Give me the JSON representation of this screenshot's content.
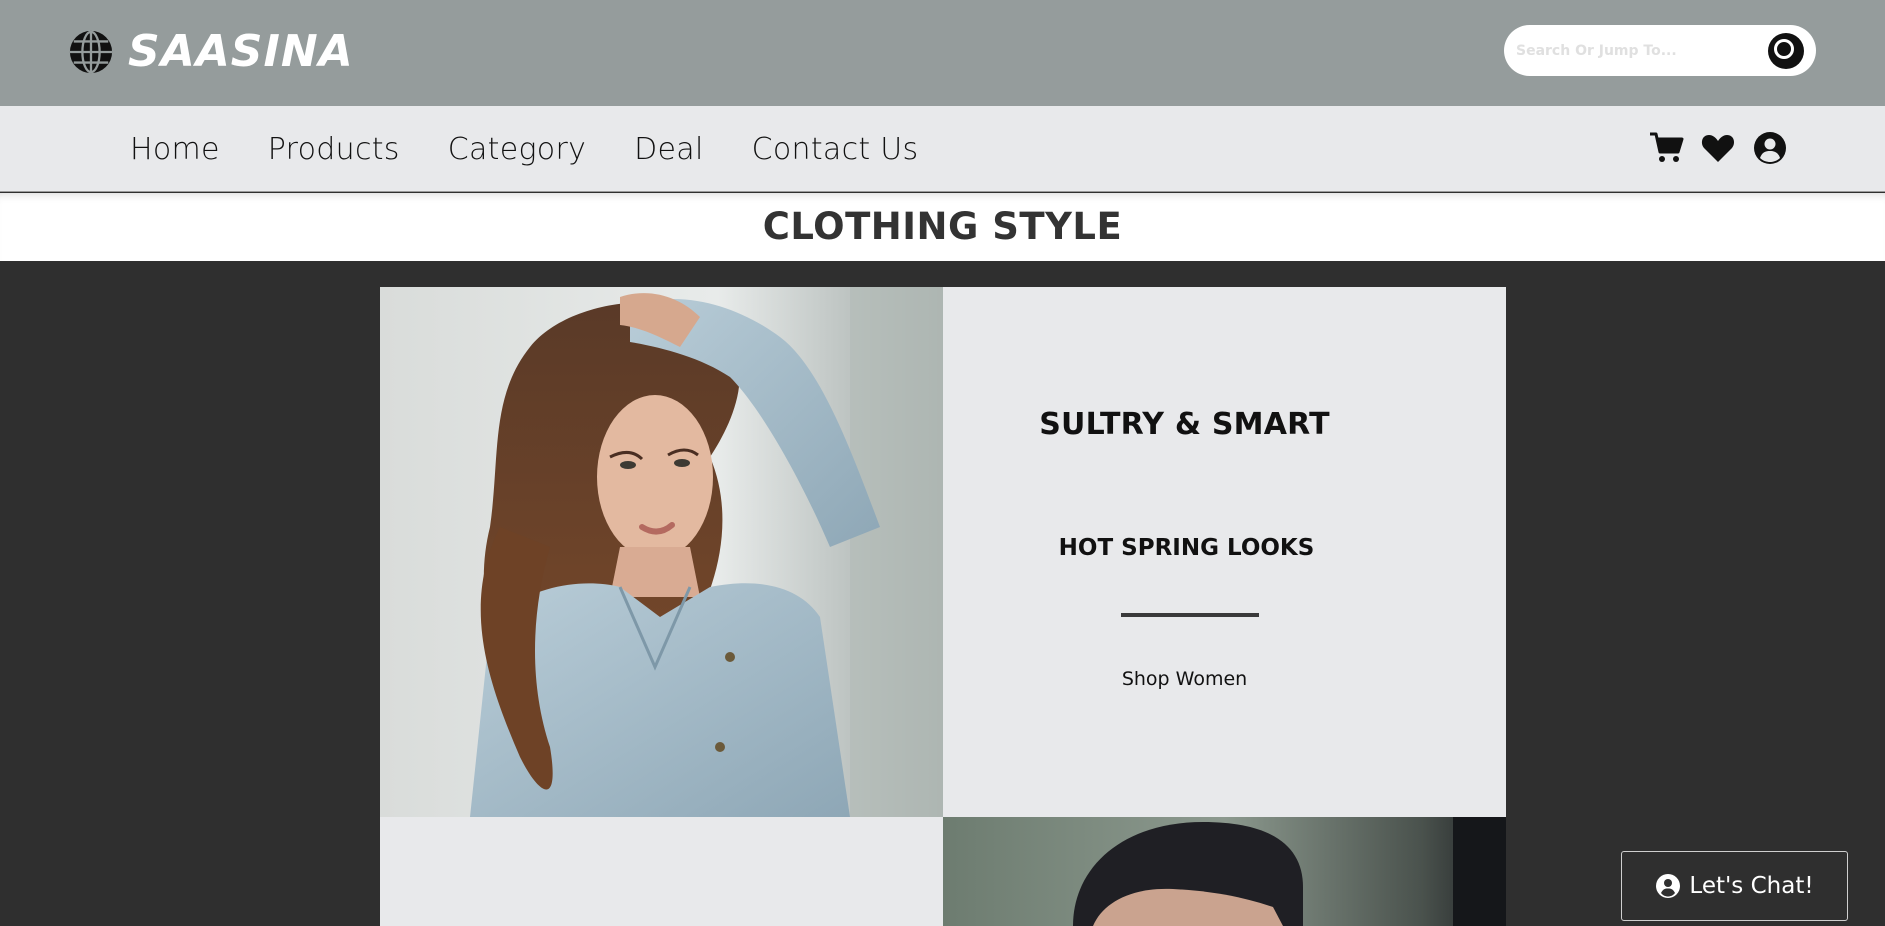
{
  "brand": {
    "name": "SAASINA",
    "icon": "globe-icon"
  },
  "search": {
    "placeholder": "Search Or Jump To...",
    "icon": "search-icon"
  },
  "nav": {
    "links": [
      "Home",
      "Products",
      "Category",
      "Deal",
      "Contact Us"
    ],
    "icons": [
      "cart-icon",
      "heart-icon",
      "user-circle-icon"
    ]
  },
  "section": {
    "title": "CLOTHING STYLE"
  },
  "promo": {
    "title": "SULTRY & SMART",
    "subtitle": "HOT SPRING LOOKS",
    "link": "Shop Women"
  },
  "chat": {
    "label": "Let's Chat!",
    "icon": "user-circle-icon"
  },
  "colors": {
    "topbar": "#959c9c",
    "navbar": "#e8e9eb",
    "page_bg": "#2f2f2f",
    "tile_bg": "#e8e9eb"
  }
}
